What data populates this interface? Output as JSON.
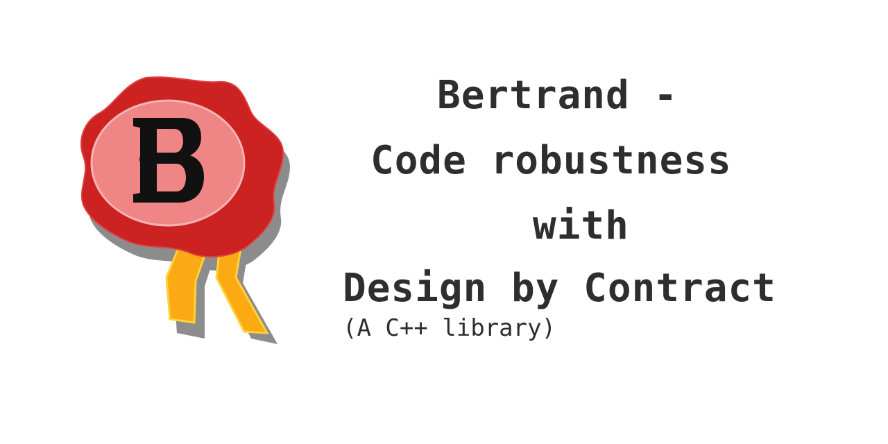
{
  "logo": {
    "letter": "B",
    "colors": {
      "seal_outer": "#cc2222",
      "seal_inner": "#ef8585",
      "seal_rim": "#f6b5b5",
      "ribbon": "#fbaa14",
      "ribbon_edge": "#ffd23a",
      "shadow": "#8a8a8a",
      "letter": "#111111"
    }
  },
  "title": {
    "line1": "Bertrand -",
    "line2": "Code robustness",
    "line3": "with",
    "line4": "Design by Contract",
    "subtitle": "(A C++ library)"
  },
  "colors": {
    "background": "#ffffff",
    "text": "#2e2e2e"
  }
}
